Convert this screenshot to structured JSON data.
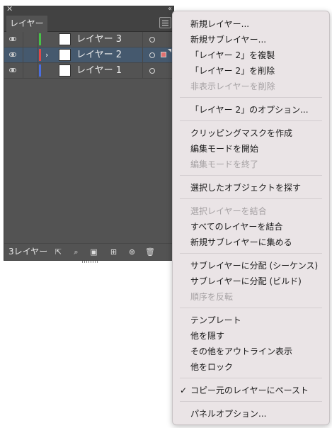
{
  "panel": {
    "tab_label": "レイヤー",
    "close_glyph": "✕",
    "collapse_glyph": "‹‹",
    "layers": [
      {
        "name": "レイヤー 3",
        "color": "#47c147",
        "selected": false,
        "expand": ""
      },
      {
        "name": "レイヤー 2",
        "color": "#e04848",
        "selected": true,
        "expand": "›"
      },
      {
        "name": "レイヤー 1",
        "color": "#4a6ee0",
        "selected": false,
        "expand": ""
      }
    ],
    "footer_count": "3レイヤー",
    "footer_icons": {
      "export": "⇱",
      "locate": "⌕",
      "clip": "▣",
      "new_sublayer": "⊞",
      "new_layer": "⊕",
      "delete": "🗑"
    }
  },
  "menu": {
    "items": [
      {
        "label": "新規レイヤー...",
        "disabled": false
      },
      {
        "label": "新規サブレイヤー...",
        "disabled": false
      },
      {
        "label": "「レイヤー 2」を複製",
        "disabled": false
      },
      {
        "label": "「レイヤー 2」を削除",
        "disabled": false
      },
      {
        "label": "非表示レイヤーを削除",
        "disabled": true
      },
      {
        "label": "「レイヤー 2」のオプション...",
        "disabled": false
      },
      {
        "label": "クリッピングマスクを作成",
        "disabled": false
      },
      {
        "label": "編集モードを開始",
        "disabled": false
      },
      {
        "label": "編集モードを終了",
        "disabled": true
      },
      {
        "label": "選択したオブジェクトを探す",
        "disabled": false
      },
      {
        "label": "選択レイヤーを結合",
        "disabled": true
      },
      {
        "label": "すべてのレイヤーを結合",
        "disabled": false
      },
      {
        "label": "新規サブレイヤーに集める",
        "disabled": false
      },
      {
        "label": "サブレイヤーに分配 (シーケンス)",
        "disabled": false
      },
      {
        "label": "サブレイヤーに分配 (ビルド)",
        "disabled": false
      },
      {
        "label": "順序を反転",
        "disabled": true
      },
      {
        "label": "テンプレート",
        "disabled": false
      },
      {
        "label": "他を隠す",
        "disabled": false
      },
      {
        "label": "その他をアウトライン表示",
        "disabled": false
      },
      {
        "label": "他をロック",
        "disabled": false
      },
      {
        "label": "コピー元のレイヤーにペースト",
        "disabled": false,
        "checked": true
      },
      {
        "label": "パネルオプション...",
        "disabled": false
      }
    ],
    "check_glyph": "✓"
  }
}
